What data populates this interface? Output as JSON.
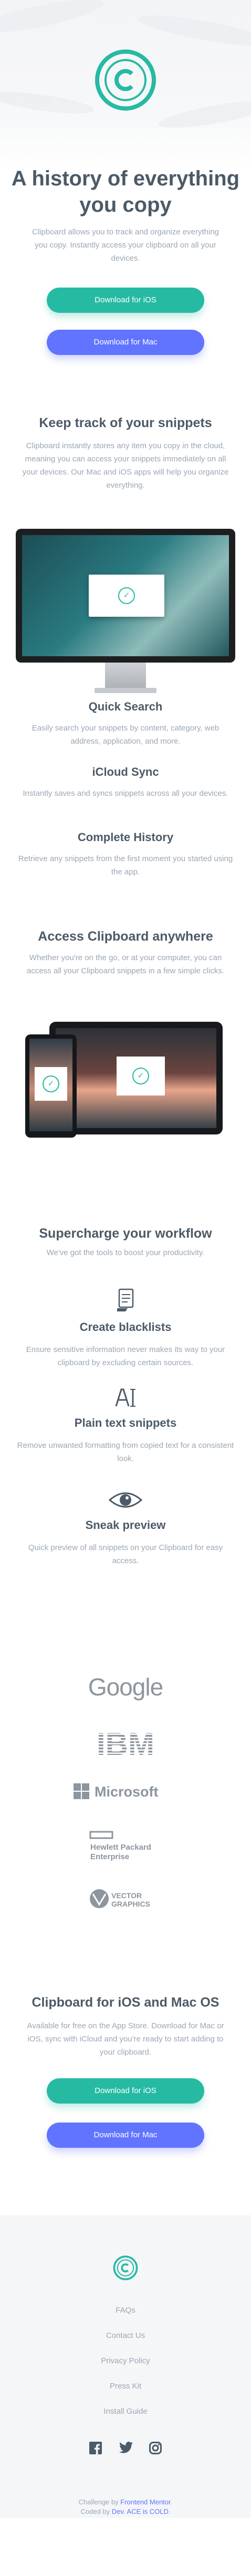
{
  "hero": {
    "title": "A history of everything you copy",
    "description": "Clipboard allows you to track and organize everything you copy. Instantly access your clipboard on all your devices.",
    "ios_button": "Download for iOS",
    "mac_button": "Download for Mac"
  },
  "snippets": {
    "title": "Keep track of your snippets",
    "description": "Clipboard instantly stores any item you copy in the cloud, meaning you can access your snippets immediately on all your devices. Our Mac and iOS apps will help you organize everything."
  },
  "features": [
    {
      "title": "Quick Search",
      "description": "Easily search your snippets by content, category, web address, application, and more."
    },
    {
      "title": "iCloud Sync",
      "description": "Instantly saves and syncs snippets across all your devices."
    },
    {
      "title": "Complete History",
      "description": "Retrieve any snippets from the first moment you started using the app."
    }
  ],
  "access": {
    "title": "Access Clipboard anywhere",
    "description": "Whether you're on the go, or at your computer, you can access all your Clipboard snippets in a few simple clicks."
  },
  "workflow": {
    "title": "Supercharge your workflow",
    "description": "We've got the tools to boost your productivity.",
    "tools": [
      {
        "icon": "blacklist-icon",
        "title": "Create blacklists",
        "description": "Ensure sensitive information never makes its way to your clipboard by excluding certain sources."
      },
      {
        "icon": "text-icon",
        "title": "Plain text snippets",
        "description": "Remove unwanted formatting from copied text for a consistent look."
      },
      {
        "icon": "eye-icon",
        "title": "Sneak preview",
        "description": "Quick preview of all snippets on your Clipboard for easy access."
      }
    ]
  },
  "logos": {
    "google": "Google",
    "ibm": "IBM",
    "microsoft": "Microsoft",
    "hp_line1": "Hewlett Packard",
    "hp_line2": "Enterprise",
    "vector_line1": "VECTOR",
    "vector_line2": "GRAPHICS"
  },
  "cta": {
    "title": "Clipboard for iOS and Mac OS",
    "description": "Available for free on the App Store. Download for Mac or iOS, sync with iCloud and you're ready to start adding to your clipboard.",
    "ios_button": "Download for iOS",
    "mac_button": "Download for Mac"
  },
  "footer": {
    "nav": [
      "FAQs",
      "Contact Us",
      "Privacy Policy",
      "Press Kit",
      "Install Guide"
    ],
    "social": [
      "facebook-icon",
      "twitter-icon",
      "instagram-icon"
    ],
    "attribution_prefix": "Challenge by",
    "attribution_challenge": "Frontend Mentor",
    "attribution_coded": "Coded by",
    "attribution_author": "Dev. ACE is COLD"
  },
  "colors": {
    "primary_green": "#26baa3",
    "primary_blue": "#6174ff",
    "heading": "#4c5a67",
    "body_text": "#9ca7b3",
    "footer_bg": "#f4f6f8"
  }
}
